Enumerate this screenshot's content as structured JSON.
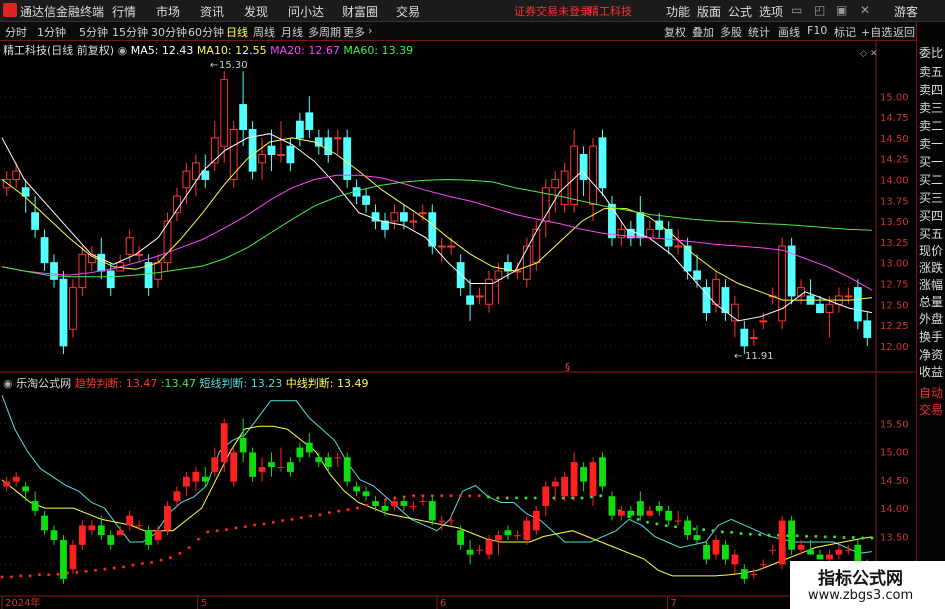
{
  "menubar": {
    "app_title": "通达信金融终端",
    "items": [
      "行情",
      "市场",
      "资讯",
      "发现",
      "问小达",
      "财富圈",
      "交易"
    ],
    "notice": "证券交易未登录",
    "stock": "精工科技",
    "right_items": [
      "功能",
      "版面",
      "公式",
      "选项"
    ],
    "guest": "游客"
  },
  "toolbar": {
    "periods": [
      "分时",
      "1分钟",
      "5分钟",
      "15分钟",
      "30分钟",
      "60分钟",
      "日线",
      "周线",
      "月线",
      "多周期",
      "更多"
    ],
    "active_period": "日线",
    "tools": [
      "复权",
      "叠加",
      "多股",
      "统计",
      "画线",
      "F10",
      "标记",
      "+自选",
      "返回"
    ]
  },
  "main_chart": {
    "stock_label": "精工科技(日线 前复权)",
    "ma": [
      {
        "label": "MA5: 12.43",
        "color": "#ffffff"
      },
      {
        "label": "MA10: 12.55",
        "color": "#ffff44"
      },
      {
        "label": "MA20: 12.67",
        "color": "#ff44ff"
      },
      {
        "label": "MA60: 13.39",
        "color": "#44ee44"
      }
    ],
    "high_label": "15.30",
    "low_label": "11.91",
    "marker": "§"
  },
  "sub_chart": {
    "name": "乐淘公式网",
    "items": [
      {
        "label": "趋势判断:",
        "value": "13.47",
        "color": "#ff3333"
      },
      {
        "label": "",
        "value": ":13.47",
        "color": "#44ee44"
      },
      {
        "label": "短线判断:",
        "value": "13.23",
        "color": "#55dddd"
      },
      {
        "label": "中线判断:",
        "value": "13.49",
        "color": "#ffff44"
      }
    ]
  },
  "xaxis": [
    "2024年",
    "5",
    "6",
    "7"
  ],
  "right_panel": {
    "items": [
      "委比",
      "卖五",
      "卖四",
      "卖三",
      "卖二",
      "卖一",
      "买一",
      "买二",
      "买三",
      "买四",
      "买五",
      "现价",
      "涨跌",
      "涨幅",
      "总量",
      "外盘",
      "换手",
      "净资",
      "收益"
    ],
    "sub_items": [
      "自动",
      "交易"
    ]
  },
  "watermark": {
    "line1": "指标公式网",
    "line2": "www.zbgs3.com"
  },
  "chart_data": [
    {
      "type": "candlestick",
      "title": "精工科技(日线 前复权)",
      "yticks": [
        12.0,
        12.25,
        12.5,
        12.75,
        13.0,
        13.25,
        13.5,
        13.75,
        14.0,
        14.25,
        14.5,
        14.75,
        15.0
      ],
      "ylim": [
        11.83,
        15.58
      ],
      "candles": [
        [
          13.9,
          14.1,
          13.8,
          14.0
        ],
        [
          14.0,
          14.2,
          13.9,
          14.1
        ],
        [
          13.9,
          14.0,
          13.6,
          13.8
        ],
        [
          13.6,
          13.8,
          13.3,
          13.4
        ],
        [
          13.3,
          13.4,
          12.9,
          13.0
        ],
        [
          13.0,
          13.1,
          12.7,
          12.8
        ],
        [
          12.8,
          12.9,
          11.9,
          12.0
        ],
        [
          12.2,
          12.8,
          12.1,
          12.7
        ],
        [
          12.7,
          13.2,
          12.6,
          13.1
        ],
        [
          13.0,
          13.2,
          12.9,
          13.1
        ],
        [
          13.1,
          13.3,
          12.8,
          12.9
        ],
        [
          12.9,
          13.0,
          12.6,
          12.7
        ],
        [
          12.9,
          13.1,
          12.9,
          13.0
        ],
        [
          13.1,
          13.4,
          13.0,
          13.3
        ],
        [
          13.1,
          13.2,
          13.0,
          13.1
        ],
        [
          13.0,
          13.1,
          12.6,
          12.7
        ],
        [
          12.8,
          13.1,
          12.7,
          13.0
        ],
        [
          13.0,
          13.6,
          12.9,
          13.5
        ],
        [
          13.6,
          13.9,
          13.5,
          13.8
        ],
        [
          13.9,
          14.2,
          13.7,
          14.1
        ],
        [
          14.0,
          14.3,
          13.8,
          14.2
        ],
        [
          14.1,
          14.3,
          13.9,
          14.0
        ],
        [
          14.2,
          14.7,
          14.1,
          14.5
        ],
        [
          14.4,
          15.3,
          14.2,
          15.2
        ],
        [
          14.0,
          14.7,
          13.9,
          14.6
        ],
        [
          14.9,
          15.3,
          14.4,
          14.6
        ],
        [
          14.6,
          14.7,
          14.0,
          14.1
        ],
        [
          14.2,
          14.5,
          14.0,
          14.3
        ],
        [
          14.4,
          14.6,
          14.1,
          14.3
        ],
        [
          14.3,
          14.7,
          14.2,
          14.3
        ],
        [
          14.4,
          14.5,
          14.1,
          14.2
        ],
        [
          14.7,
          14.8,
          14.4,
          14.5
        ],
        [
          14.8,
          15.0,
          14.5,
          14.6
        ],
        [
          14.5,
          14.6,
          14.3,
          14.4
        ],
        [
          14.5,
          14.6,
          14.2,
          14.3
        ],
        [
          14.5,
          14.6,
          14.3,
          14.5
        ],
        [
          14.5,
          14.6,
          13.9,
          14.0
        ],
        [
          13.9,
          14.0,
          13.7,
          13.8
        ],
        [
          13.8,
          13.9,
          13.6,
          13.7
        ],
        [
          13.6,
          13.7,
          13.4,
          13.5
        ],
        [
          13.5,
          13.6,
          13.3,
          13.4
        ],
        [
          13.5,
          13.7,
          13.4,
          13.6
        ],
        [
          13.6,
          13.7,
          13.4,
          13.5
        ],
        [
          13.5,
          13.6,
          13.4,
          13.5
        ],
        [
          13.6,
          13.7,
          13.5,
          13.6
        ],
        [
          13.6,
          13.7,
          13.1,
          13.2
        ],
        [
          13.2,
          13.3,
          13.0,
          13.2
        ],
        [
          13.2,
          13.3,
          13.1,
          13.2
        ],
        [
          13.0,
          13.1,
          12.6,
          12.7
        ],
        [
          12.6,
          12.8,
          12.3,
          12.5
        ],
        [
          12.6,
          12.7,
          12.5,
          12.6
        ],
        [
          12.5,
          12.9,
          12.4,
          12.8
        ],
        [
          12.8,
          13.0,
          12.5,
          12.9
        ],
        [
          13.0,
          13.1,
          12.8,
          12.9
        ],
        [
          12.9,
          13.0,
          12.8,
          12.9
        ],
        [
          12.8,
          13.3,
          12.7,
          13.2
        ],
        [
          13.0,
          13.5,
          12.9,
          13.4
        ],
        [
          13.5,
          14.0,
          13.3,
          13.9
        ],
        [
          13.9,
          14.1,
          13.6,
          14.0
        ],
        [
          13.7,
          14.2,
          13.6,
          14.1
        ],
        [
          13.7,
          14.6,
          13.6,
          14.4
        ],
        [
          14.3,
          14.4,
          13.8,
          14.0
        ],
        [
          13.7,
          14.5,
          13.5,
          14.4
        ],
        [
          14.5,
          14.6,
          13.8,
          13.9
        ],
        [
          13.7,
          13.8,
          13.2,
          13.3
        ],
        [
          13.3,
          13.5,
          13.2,
          13.4
        ],
        [
          13.4,
          13.5,
          13.2,
          13.3
        ],
        [
          13.6,
          13.8,
          13.2,
          13.3
        ],
        [
          13.3,
          13.5,
          13.3,
          13.4
        ],
        [
          13.5,
          13.6,
          13.3,
          13.4
        ],
        [
          13.4,
          13.5,
          13.1,
          13.2
        ],
        [
          13.2,
          13.4,
          13.1,
          13.2
        ],
        [
          13.2,
          13.3,
          12.8,
          12.9
        ],
        [
          12.9,
          13.1,
          12.7,
          12.8
        ],
        [
          12.7,
          12.8,
          12.3,
          12.4
        ],
        [
          12.5,
          12.9,
          12.4,
          12.8
        ],
        [
          12.7,
          12.8,
          12.3,
          12.4
        ],
        [
          12.3,
          12.6,
          12.1,
          12.5
        ],
        [
          12.2,
          12.3,
          11.9,
          12.0
        ],
        [
          12.1,
          12.2,
          12.0,
          12.1
        ],
        [
          12.3,
          12.4,
          12.2,
          12.3
        ],
        [
          12.6,
          12.7,
          12.5,
          12.6
        ],
        [
          12.3,
          13.3,
          12.2,
          13.2
        ],
        [
          13.2,
          13.3,
          12.5,
          12.6
        ],
        [
          12.6,
          12.8,
          12.5,
          12.7
        ],
        [
          12.6,
          12.8,
          12.5,
          12.5
        ],
        [
          12.5,
          12.6,
          12.4,
          12.4
        ],
        [
          12.4,
          12.6,
          12.1,
          12.5
        ],
        [
          12.5,
          12.7,
          12.4,
          12.6
        ],
        [
          12.6,
          12.7,
          12.5,
          12.6
        ],
        [
          12.7,
          12.8,
          12.2,
          12.3
        ],
        [
          12.3,
          12.4,
          12.0,
          12.1
        ]
      ],
      "ma_series": [
        {
          "name": "MA5",
          "color": "#ffffff",
          "values": [
            14.5,
            14.0,
            13.7,
            13.4,
            13.1,
            12.98,
            13.1,
            13.3,
            13.7,
            14.1,
            14.35,
            14.5,
            14.55,
            14.42,
            14.22,
            13.93,
            13.6,
            13.5,
            13.45,
            13.3,
            13.0,
            12.75,
            12.75,
            12.9,
            13.4,
            13.85,
            14.1,
            13.8,
            13.4,
            13.3,
            13.1,
            12.8,
            12.5,
            12.3,
            12.35,
            12.45,
            12.65,
            12.55,
            12.45,
            12.4
          ]
        },
        {
          "name": "MA10",
          "color": "#ffff44",
          "values": [
            14.0,
            13.8,
            13.55,
            13.3,
            13.08,
            12.95,
            12.92,
            13.0,
            13.28,
            13.6,
            13.95,
            14.25,
            14.45,
            14.5,
            14.45,
            14.3,
            14.1,
            13.88,
            13.7,
            13.52,
            13.3,
            13.1,
            12.95,
            12.9,
            13.0,
            13.25,
            13.5,
            13.65,
            13.65,
            13.55,
            13.35,
            13.1,
            12.9,
            12.75,
            12.65,
            12.55,
            12.55,
            12.55,
            12.55,
            12.58
          ]
        },
        {
          "name": "MA20",
          "color": "#ff44ff",
          "values": [
            12.95,
            12.9,
            12.87,
            12.85,
            12.88,
            12.93,
            13.0,
            13.08,
            13.18,
            13.28,
            13.42,
            13.57,
            13.75,
            13.9,
            14.0,
            14.05,
            14.05,
            14.02,
            13.95,
            13.87,
            13.8,
            13.74,
            13.66,
            13.58,
            13.52,
            13.47,
            13.4,
            13.35,
            13.32,
            13.3,
            13.28,
            13.25,
            13.22,
            13.2,
            13.18,
            13.15,
            13.05,
            12.95,
            12.82,
            12.67
          ]
        },
        {
          "name": "MA60",
          "color": "#44ee44",
          "values": [
            12.95,
            12.9,
            12.85,
            12.83,
            12.83,
            12.83,
            12.85,
            12.88,
            12.92,
            12.96,
            13.05,
            13.18,
            13.35,
            13.52,
            13.68,
            13.79,
            13.87,
            13.93,
            13.97,
            13.99,
            14.0,
            13.99,
            13.97,
            13.9,
            13.85,
            13.8,
            13.74,
            13.68,
            13.63,
            13.58,
            13.55,
            13.52,
            13.5,
            13.49,
            13.47,
            13.46,
            13.44,
            13.42,
            13.4,
            13.39
          ]
        }
      ]
    },
    {
      "type": "line",
      "title": "乐淘公式网",
      "yticks": [
        13.0,
        13.5,
        14.0,
        14.5,
        15.0,
        15.5
      ],
      "ylim": [
        12.55,
        15.95
      ],
      "trend": [
        12.78,
        12.78,
        12.8,
        12.8,
        12.82,
        12.82,
        12.83,
        12.85,
        12.86,
        12.88,
        12.9,
        12.92,
        12.94,
        12.96,
        12.99,
        13.02,
        13.04,
        13.08,
        13.12,
        13.2,
        13.3,
        13.45,
        13.58,
        13.6,
        13.62,
        13.65,
        13.67,
        13.7,
        13.72,
        13.75,
        13.78,
        13.8,
        13.83,
        13.86,
        13.88,
        13.92,
        13.95,
        13.97,
        14.0,
        14.05,
        14.1,
        14.15,
        14.18,
        14.2,
        14.22,
        14.22,
        14.22,
        14.22,
        14.22,
        14.22,
        14.22,
        14.22,
        14.2,
        14.18,
        14.18,
        14.18,
        14.18,
        14.18,
        14.18,
        14.18,
        14.18,
        14.18,
        14.18,
        14.2,
        14.22,
        14.1,
        13.95,
        13.85,
        13.8,
        13.75,
        13.72,
        13.69,
        13.67,
        13.65,
        13.63,
        13.62,
        13.6,
        13.58,
        13.57,
        13.55,
        13.54,
        13.53,
        13.52,
        13.52,
        13.51,
        13.51,
        13.5,
        13.5,
        13.49,
        13.49,
        13.48,
        13.48,
        13.47,
        13.47
      ],
      "short_line": [
        16.0,
        15.4,
        15.0,
        14.7,
        14.55,
        14.4,
        14.3,
        14.1,
        14.0,
        13.7,
        13.4,
        13.4,
        13.55,
        13.9,
        14.1,
        14.2,
        14.4,
        15.0,
        15.2,
        15.3,
        15.6,
        15.9,
        15.9,
        15.9,
        15.6,
        15.4,
        15.2,
        14.8,
        14.5,
        14.4,
        14.2,
        14.0,
        13.8,
        13.7,
        13.6,
        13.8,
        14.3,
        14.4,
        14.2,
        14.1,
        14.1,
        13.9,
        13.8,
        13.6,
        13.4,
        13.4,
        13.4,
        13.5,
        13.6,
        13.8,
        13.7,
        13.5,
        13.4,
        13.3,
        13.35,
        13.4,
        13.7,
        13.8,
        13.7,
        13.6,
        13.5,
        13.45,
        13.4,
        13.4,
        13.4,
        13.4,
        13.3,
        13.2,
        13.23
      ],
      "mid_line": [
        14.5,
        14.3,
        14.1,
        14.0,
        14.0,
        14.0,
        13.9,
        13.8,
        13.75,
        13.7,
        13.6,
        13.6,
        13.6,
        13.8,
        14.0,
        14.5,
        15.0,
        15.4,
        15.45,
        15.45,
        15.4,
        15.2,
        15.0,
        14.6,
        14.3,
        14.1,
        14.0,
        13.9,
        13.85,
        13.8,
        13.75,
        13.7,
        13.65,
        13.55,
        13.45,
        13.4,
        13.4,
        13.4,
        13.5,
        13.55,
        13.6,
        13.5,
        13.4,
        13.3,
        13.2,
        13.1,
        12.9,
        12.8,
        12.8,
        12.8,
        12.8,
        12.82,
        12.85,
        12.9,
        13.0,
        13.1,
        13.2,
        13.3,
        13.35,
        13.4,
        13.45,
        13.49
      ]
    }
  ]
}
